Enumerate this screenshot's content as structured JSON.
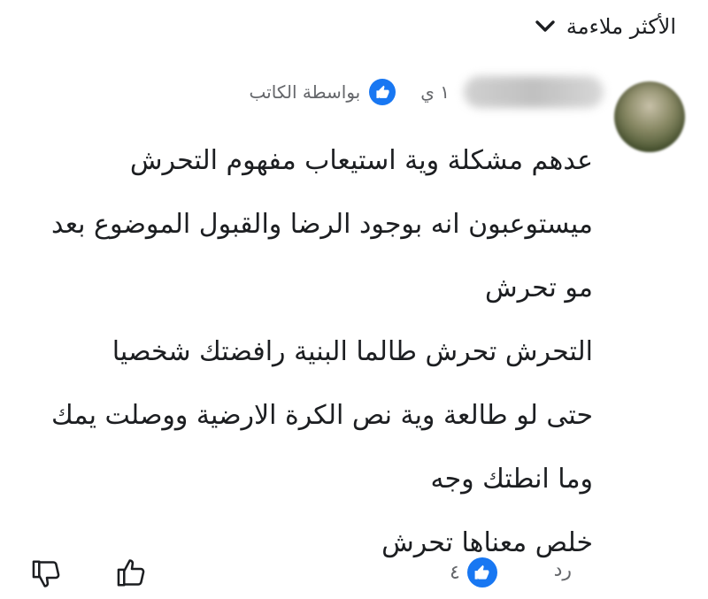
{
  "sort": {
    "label": "الأكثر ملاءمة"
  },
  "comment": {
    "time": "١ ي",
    "author_tag": "بواسطة الكاتب",
    "lines": [
      "عدهم مشكلة وية استيعاب مفهوم التحرش",
      "ميستوعبون انه بوجود الرضا والقبول الموضوع بعد",
      "مو تحرش",
      "التحرش تحرش طالما البنية رافضتك شخصيا",
      "حتى لو طالعة وية نص الكرة الارضية ووصلت يمك",
      "وما انطتك وجه",
      "خلص معناها تحرش"
    ]
  },
  "footer": {
    "reply_label": "رد",
    "reaction_count": "٤"
  },
  "colors": {
    "brand_blue": "#1877f2",
    "secondary_text": "#65676b",
    "primary_text": "#1c1e21"
  }
}
